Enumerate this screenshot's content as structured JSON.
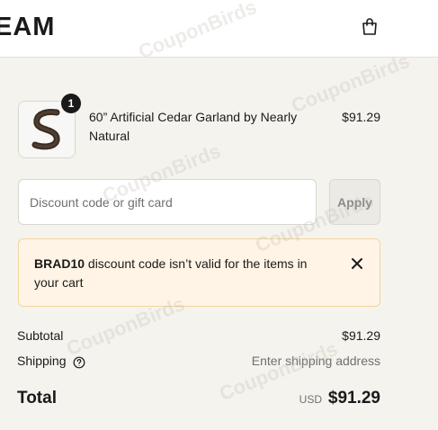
{
  "header": {
    "logo_text": "EAM",
    "cart_icon": "shopping-bag-icon"
  },
  "product": {
    "title": "60” Artificial Cedar Garland by Nearly Natural",
    "price": "$91.29",
    "quantity": "1",
    "image_icon": "garland-image"
  },
  "discount": {
    "placeholder": "Discount code or gift card",
    "value": "",
    "apply_label": "Apply"
  },
  "error": {
    "code": "BRAD10",
    "message": " discount code isn’t valid for the items in your cart",
    "close_icon": "close-icon"
  },
  "summary": {
    "subtotal_label": "Subtotal",
    "subtotal_value": "$91.29",
    "shipping_label": "Shipping",
    "shipping_value": "Enter shipping address",
    "help_icon": "question-circle-icon"
  },
  "total": {
    "label": "Total",
    "currency": "USD",
    "amount": "$91.29"
  },
  "watermark": {
    "text": "CouponBirds"
  },
  "colors": {
    "page_bg": "#f5f3ee",
    "error_bg": "#fff4e6",
    "error_border": "#f1d59e",
    "badge_bg": "#1a1a1a"
  }
}
